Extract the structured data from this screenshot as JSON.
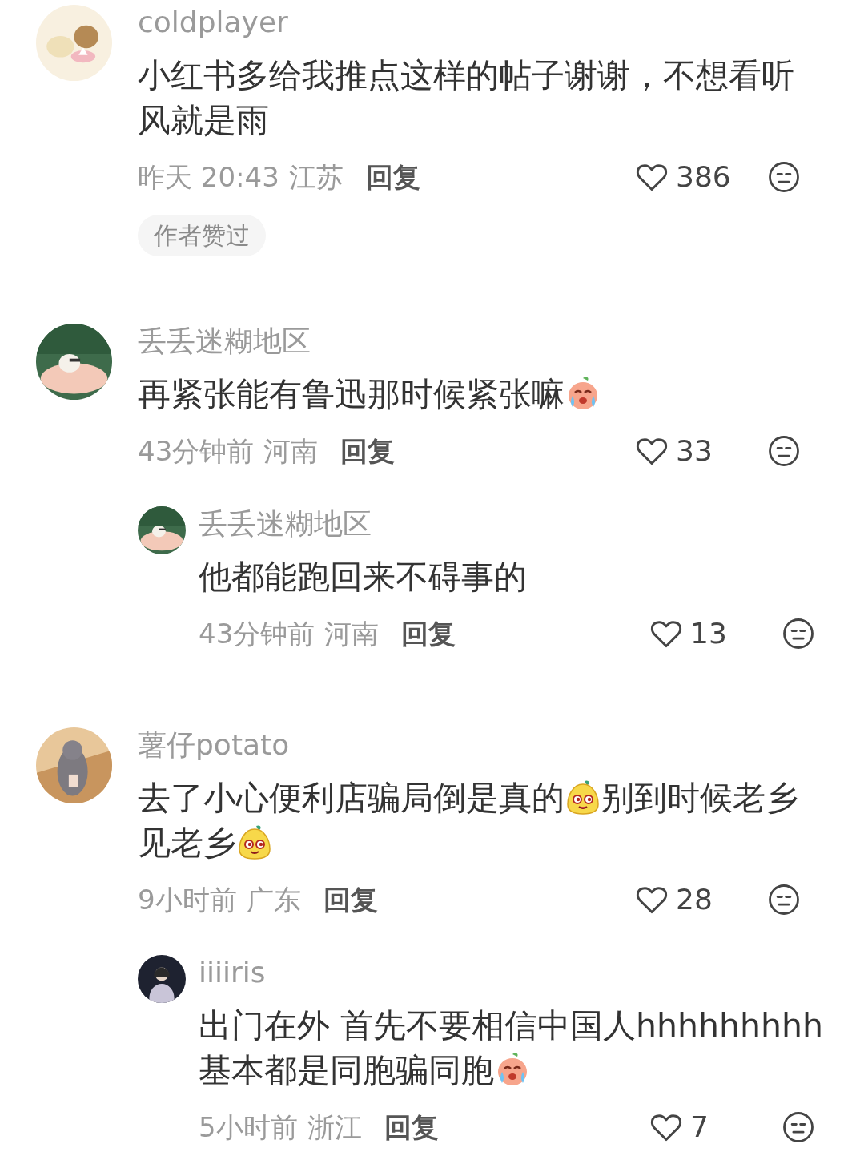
{
  "comments": [
    {
      "author": "coldplayer",
      "body": [
        {
          "kind": "text",
          "text": "小红书多给我推点这样的帖子谢谢，不想看听风就是雨"
        }
      ],
      "time": "昨天 20:43",
      "location": "江苏",
      "reply_label": "回复",
      "likes": "386",
      "liked": false,
      "badge": "作者赞过"
    },
    {
      "author": "丢丢迷糊地区",
      "body": [
        {
          "kind": "text",
          "text": "再紧张能有鲁迅那时候紧张嘛"
        },
        {
          "kind": "crying"
        }
      ],
      "time": "43分钟前",
      "location": "河南",
      "reply_label": "回复",
      "likes": "33",
      "liked": false,
      "replies": [
        {
          "author": "丢丢迷糊地区",
          "body": [
            {
              "kind": "text",
              "text": "他都能跑回来不碍事的"
            }
          ],
          "time": "43分钟前",
          "location": "河南",
          "reply_label": "回复",
          "likes": "13",
          "liked": false
        }
      ]
    },
    {
      "author": "薯仔potato",
      "body": [
        {
          "kind": "text",
          "text": "去了小心便利店骗局倒是真的"
        },
        {
          "kind": "grinning"
        },
        {
          "kind": "text",
          "text": "别到时候老乡见老乡"
        },
        {
          "kind": "grinning"
        }
      ],
      "time": "9小时前",
      "location": "广东",
      "reply_label": "回复",
      "likes": "28",
      "liked": false,
      "replies": [
        {
          "author": "iiiiris",
          "body": [
            {
              "kind": "text",
              "text": "出门在外 首先不要相信中国人hhhhhhhhh基本都是同胞骗同胞"
            },
            {
              "kind": "crying"
            }
          ],
          "time": "5小时前",
          "location": "浙江",
          "reply_label": "回复",
          "likes": "7",
          "liked": false
        }
      ]
    }
  ]
}
